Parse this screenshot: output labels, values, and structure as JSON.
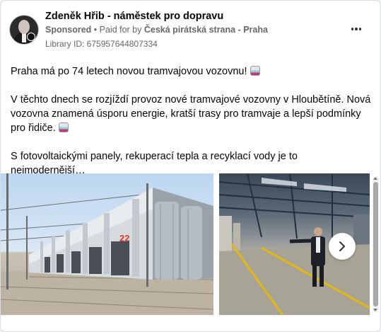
{
  "post": {
    "author": "Zdeněk Hřib - náměstek pro dopravu",
    "sponsored": "Sponsored",
    "separator": " • ",
    "paid_for_prefix": "Paid for by ",
    "paid_for_by": "Česká pirátská strana - Praha",
    "library_id": "Library ID: 675957644807334",
    "paragraphs": [
      "Praha má po 74 letech novou tramvajovou vozovnu!",
      "V těchto dnech se rozjíždí provoz nové tramvajové vozovny v Hloubětíně. Nová vozovna znamená úsporu energie, kratší trasy pro tramvaje a lepší podmínky pro řidiče.",
      "S fotovoltaickými panely, rekuperací tepla a recyklací vody je to nejmodernější…"
    ]
  },
  "gallery": {
    "image1": {
      "depot_number": "22",
      "icon": "depot-exterior-photo"
    },
    "image2": {
      "icon": "depot-interior-photo"
    },
    "next_icon": "chevron-right-icon"
  },
  "colors": {
    "meta_gray": "#65676b",
    "card_border": "#dadde1",
    "yellow_line": "#e2b814",
    "number_red": "#e2352a"
  }
}
